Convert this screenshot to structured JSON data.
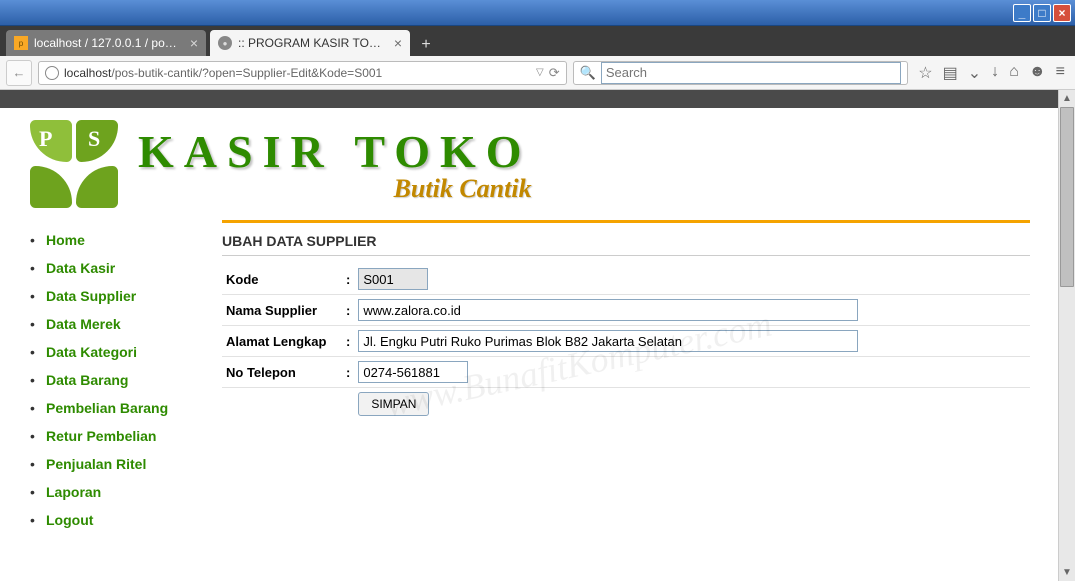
{
  "window": {
    "tabs": [
      {
        "title": "localhost / 127.0.0.1 / pos_b...",
        "active": false
      },
      {
        "title": ":: PROGRAM KASIR TOKO - BUTIK...",
        "active": true
      }
    ],
    "url_host": "localhost",
    "url_path": "/pos-butik-cantik/?open=Supplier-Edit&Kode=S001",
    "search_placeholder": "Search"
  },
  "site": {
    "brand_main": "KASIR TOKO",
    "brand_sub": "Butik Cantik"
  },
  "nav": [
    "Home",
    "Data Kasir",
    "Data Supplier",
    "Data Merek",
    "Data Kategori",
    "Data Barang",
    "Pembelian Barang",
    "Retur Pembelian",
    "Penjualan Ritel",
    "Laporan",
    "Logout"
  ],
  "form": {
    "title": "UBAH DATA SUPPLIER",
    "fields": {
      "kode": {
        "label": "Kode",
        "value": "S001"
      },
      "nama": {
        "label": "Nama Supplier",
        "value": "www.zalora.co.id"
      },
      "alamat": {
        "label": "Alamat Lengkap",
        "value": "Jl. Engku Putri Ruko Purimas Blok B82 Jakarta Selatan"
      },
      "telp": {
        "label": "No Telepon",
        "value": "0274-561881"
      }
    },
    "submit_label": "SIMPAN"
  },
  "watermark": "www.BunafitKomputer.com"
}
